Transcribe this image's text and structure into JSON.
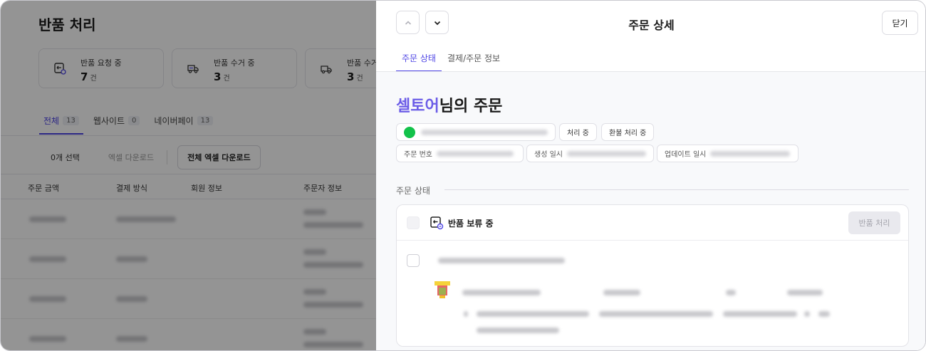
{
  "background": {
    "page_title": "반품 처리",
    "stats": [
      {
        "label": "반품 요청 중",
        "value": "7",
        "unit": "건",
        "icon": "return-request-icon"
      },
      {
        "label": "반품 수거 중",
        "value": "3",
        "unit": "건",
        "icon": "pickup-truck-icon"
      },
      {
        "label": "반품 수거",
        "value": "3",
        "unit": "건",
        "icon": "pickup-done-icon"
      }
    ],
    "tabs": [
      {
        "label": "전체",
        "count": "13"
      },
      {
        "label": "웹사이트",
        "count": "0"
      },
      {
        "label": "네이버페이",
        "count": "13"
      }
    ],
    "toolbar": {
      "selected": "0개 선택",
      "excel_download": "엑셀 다운로드",
      "excel_download_all": "전체 엑셀 다운로드"
    },
    "table_headers": [
      "주문 금액",
      "결제 방식",
      "회원 정보",
      "주문자 정보"
    ]
  },
  "drawer": {
    "title": "주문 상세",
    "close_label": "닫기",
    "tabs": [
      "주문 상태",
      "결제/주문 정보"
    ],
    "order_title": {
      "name": "셀토어",
      "suffix": "님의 주문"
    },
    "chips": {
      "processing": "처리 중",
      "refund_processing": "환불 처리 중",
      "order_number_label": "주문 번호",
      "created_label": "생성 일시",
      "updated_label": "업데이트 일시"
    },
    "section_title": "주문 상태",
    "status_card": {
      "status_label": "반품 보류 중",
      "process_button": "반품 처리"
    }
  },
  "colors": {
    "accent": "#4f46e5",
    "name_purple": "#6b5ce7",
    "naver_green": "#12c24a"
  }
}
